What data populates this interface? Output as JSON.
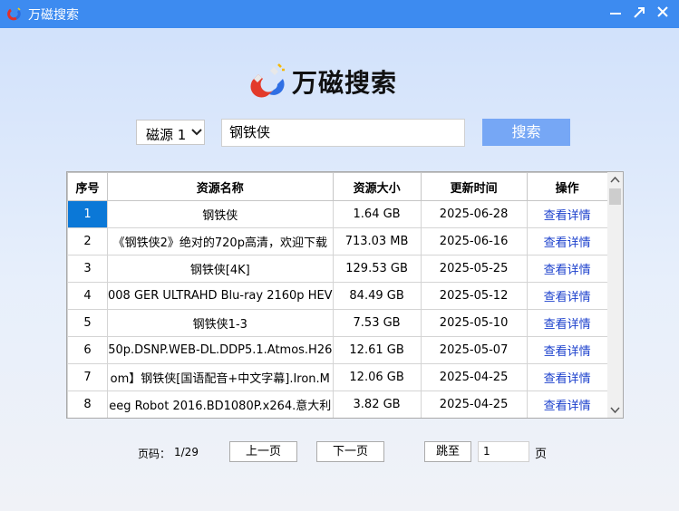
{
  "window": {
    "title": "万磁搜索"
  },
  "brand": {
    "name": "万磁搜索"
  },
  "search": {
    "source_selected": "磁源 1",
    "query": "钢铁侠",
    "button_label": "搜索"
  },
  "table": {
    "headers": [
      "序号",
      "资源名称",
      "资源大小",
      "更新时间",
      "操作"
    ],
    "rows": [
      {
        "index": "1",
        "name": "钢铁侠",
        "size": "1.64 GB",
        "date": "2025-06-28",
        "action": "查看详情"
      },
      {
        "index": "2",
        "name": "《钢铁侠2》绝对的720p高清，欢迎下载",
        "size": "713.03 MB",
        "date": "2025-06-16",
        "action": "查看详情"
      },
      {
        "index": "3",
        "name": "钢铁侠[4K]",
        "size": "129.53 GB",
        "date": "2025-05-25",
        "action": "查看详情"
      },
      {
        "index": "4",
        "name": "008 GER ULTRAHD Blu-ray 2160p HEV",
        "size": "84.49 GB",
        "date": "2025-05-12",
        "action": "查看详情"
      },
      {
        "index": "5",
        "name": "钢铁侠1-3",
        "size": "7.53 GB",
        "date": "2025-05-10",
        "action": "查看详情"
      },
      {
        "index": "6",
        "name": "50p.DSNP.WEB-DL.DDP5.1.Atmos.H26",
        "size": "12.61 GB",
        "date": "2025-05-07",
        "action": "查看详情"
      },
      {
        "index": "7",
        "name": "om】钢铁侠[国语配音+中文字幕].Iron.M",
        "size": "12.06 GB",
        "date": "2025-04-25",
        "action": "查看详情"
      },
      {
        "index": "8",
        "name": "eeg Robot 2016.BD1080P.x264.意大利",
        "size": "3.82 GB",
        "date": "2025-04-25",
        "action": "查看详情"
      }
    ]
  },
  "pager": {
    "label": "页码：",
    "value": "1/29",
    "prev_label": "上一页",
    "next_label": "下一页",
    "jump_label": "跳至",
    "page_input": "1",
    "page_unit": "页"
  },
  "colors": {
    "titlebar": "#3d8bf0",
    "accent": "#76a7f5",
    "link": "#1a3fcc",
    "selected": "#0b78d7"
  },
  "icons": [
    "magnet-icon",
    "minimize-icon",
    "maximize-icon",
    "close-icon",
    "chevron-down-icon",
    "scroll-up-icon",
    "scroll-down-icon"
  ]
}
